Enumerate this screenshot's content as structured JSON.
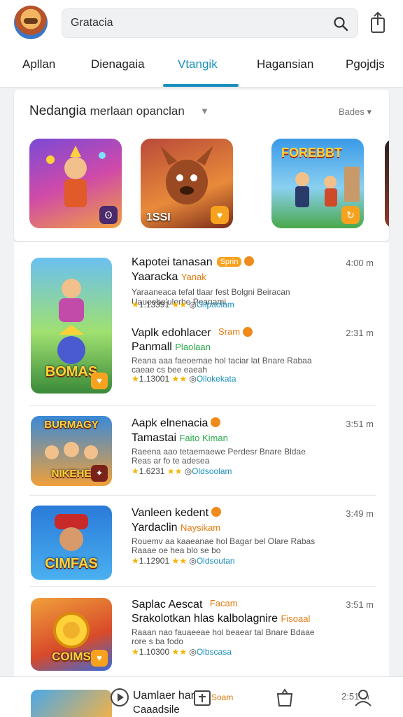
{
  "header": {
    "search_value": "Gratacia",
    "avatar_icon": "user-avatar",
    "search_icon": "search-icon",
    "share_icon": "share-icon"
  },
  "tabs": [
    {
      "label": "Apllan",
      "active": false
    },
    {
      "label": "Dienagaia",
      "active": false
    },
    {
      "label": "Vtangik",
      "active": true
    },
    {
      "label": "Hagansian",
      "active": false
    },
    {
      "label": "Pgojdjs",
      "active": false
    }
  ],
  "featured": {
    "title": "Nedangia",
    "title_light": "merlaan opanclan",
    "filter_label": "Bades",
    "tiles": [
      {
        "label": "",
        "badge": "Ꙩ"
      },
      {
        "label": "1SSI",
        "badge": "♥"
      },
      {
        "label": "",
        "word": "FOREBBT",
        "badge": "↻"
      }
    ]
  },
  "list": [
    {
      "name": "Kapotei tanasan",
      "tag": "Sprin",
      "sub": "Yaaracka",
      "sub_hl": "Yanak",
      "desc1": "Yaraaneaca tefal tlaar fest Bolgni Beiracan",
      "desc2": "Uaueebe'ulerbe Peanami",
      "rating": "1.13391",
      "stars": "★★",
      "link": "Ollpaolam",
      "time": "4:00 m",
      "thumb_word": "BOMAS"
    },
    {
      "name": "Vaplk edohlacer",
      "tag": "Sram",
      "sub": "Panmall",
      "sub_hl": "Plaolaan",
      "desc1": "Reana aaa faeoemae hol taciar lat Bnare Rabaa",
      "desc2": "caeae cs bee eaeah",
      "rating": "1.13001",
      "stars": "★★",
      "link": "Ollokekata",
      "time": "2:31 m",
      "thumb_word": ""
    },
    {
      "name": "Aapk elnenacia",
      "tag": "",
      "sub": "Tamastai",
      "sub_hl": "Faito Kiman",
      "desc1": "Raeena aao tetaemaewe Perdesr Bnare Bldae",
      "desc2": "Reas ar fo te adesea",
      "rating": "1.6231",
      "stars": "★★",
      "link": "Oldsoolam",
      "time": "3:51 m",
      "thumb_word": "NIKEHE",
      "thumb_top": "BURMAGY"
    },
    {
      "name": "Vanleen kedent",
      "tag": "",
      "sub": "Yardaclin",
      "sub_hl": "Naysikam",
      "desc1": "Rouemv aa kaaeanae hol Bagar bel Olare Rabas",
      "desc2": "Raaae oe hea blo se bo",
      "rating": "1.12901",
      "stars": "★★",
      "link": "Oldsoutan",
      "time": "3:49 m",
      "thumb_word": "CIMFAS"
    },
    {
      "name": "Saplac Aescat",
      "tag": "Facam",
      "sub": "Srakolotkan hlas kalbolagnire",
      "sub_hl": "Fisoaal",
      "desc1": "Raaan nao fauaeeae hol beaear tal Bnare Bdaae",
      "desc2": "rore s ba fodo",
      "rating": "1.10300",
      "stars": "★★",
      "link": "Olbscasa",
      "time": "3:51 m",
      "thumb_word": "COIMS"
    }
  ],
  "bottom_nav": {
    "peek_name": "Uamlaer hana",
    "peek_sub": "Caaadsile",
    "peek_tag": "Soam",
    "peek_time": "2:51 m",
    "icons": [
      "play-icon",
      "store-icon",
      "bag-icon",
      "account-icon"
    ]
  },
  "colors": {
    "accent": "#1a8fbe",
    "badge": "#f7a21e",
    "star": "#f4b400"
  }
}
